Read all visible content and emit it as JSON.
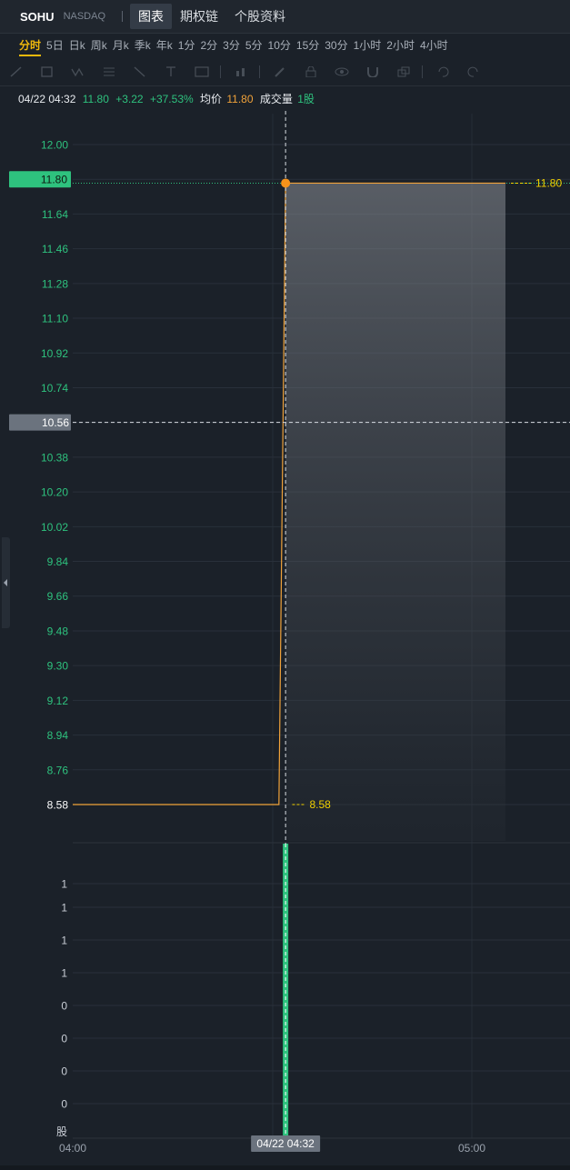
{
  "header": {
    "symbol": "SOHU",
    "exchange": "NASDAQ",
    "tabs": [
      {
        "label": "图表",
        "active": true
      },
      {
        "label": "期权链",
        "active": false
      },
      {
        "label": "个股资料",
        "active": false
      }
    ]
  },
  "periods": [
    {
      "label": "分时",
      "active": true
    },
    {
      "label": "5日"
    },
    {
      "label": "日k"
    },
    {
      "label": "周k"
    },
    {
      "label": "月k"
    },
    {
      "label": "季k"
    },
    {
      "label": "年k"
    },
    {
      "label": "1分"
    },
    {
      "label": "2分"
    },
    {
      "label": "3分"
    },
    {
      "label": "5分"
    },
    {
      "label": "10分"
    },
    {
      "label": "15分"
    },
    {
      "label": "30分"
    },
    {
      "label": "1小时"
    },
    {
      "label": "2小时"
    },
    {
      "label": "4小时"
    }
  ],
  "toolbar_icons": [
    "pen-icon",
    "rectangle-icon",
    "wave-icon",
    "grid-icon",
    "arrow-icon",
    "text-icon",
    "image-icon",
    "bar-chart-icon",
    "brush-icon",
    "lock-icon",
    "eye-icon",
    "magnet-icon",
    "layers-icon",
    "undo-icon",
    "redo-icon"
  ],
  "info": {
    "datetime": "04/22 04:32",
    "price": "11.80",
    "change": "+3.22",
    "change_pct": "+37.53%",
    "avg_label": "均价",
    "avg": "11.80",
    "volume_label": "成交量",
    "volume": "1股"
  },
  "colors": {
    "up": "#2ec27e",
    "line": "#f0a23a",
    "marker_label": "#f0d000",
    "background": "#1b2129",
    "price_tag_bg": "#2ec27e",
    "crosshair_tag_bg": "#6b737e"
  },
  "chart_data": {
    "type": "line",
    "price_ticks": [
      "12.00",
      "11.80",
      "11.64",
      "11.46",
      "11.28",
      "11.10",
      "10.92",
      "10.74",
      "10.56",
      "10.38",
      "10.20",
      "10.02",
      "9.84",
      "9.66",
      "9.48",
      "9.30",
      "9.12",
      "8.94",
      "8.76",
      "8.58"
    ],
    "ylim": [
      8.58,
      12.0
    ],
    "x_ticks": [
      "04:00",
      "05:00"
    ],
    "xlim_minutes": [
      0,
      60
    ],
    "series": [
      {
        "x": [
          0,
          31,
          32,
          65
        ],
        "y": [
          8.58,
          8.58,
          11.8,
          11.8
        ]
      }
    ],
    "prev_close": 8.58,
    "last_price": 11.8,
    "price_label": "11.80",
    "low_label": "8.58",
    "crosshair": {
      "price": 10.56,
      "price_label": "10.56",
      "time_label": "04/22 04:32",
      "x": 32
    },
    "volume": {
      "ticks": [
        "1",
        "1",
        "1",
        "1",
        "0",
        "0",
        "0",
        "0"
      ],
      "unit_label": "股",
      "bars": [
        {
          "x": 32,
          "v": 1
        }
      ]
    }
  }
}
